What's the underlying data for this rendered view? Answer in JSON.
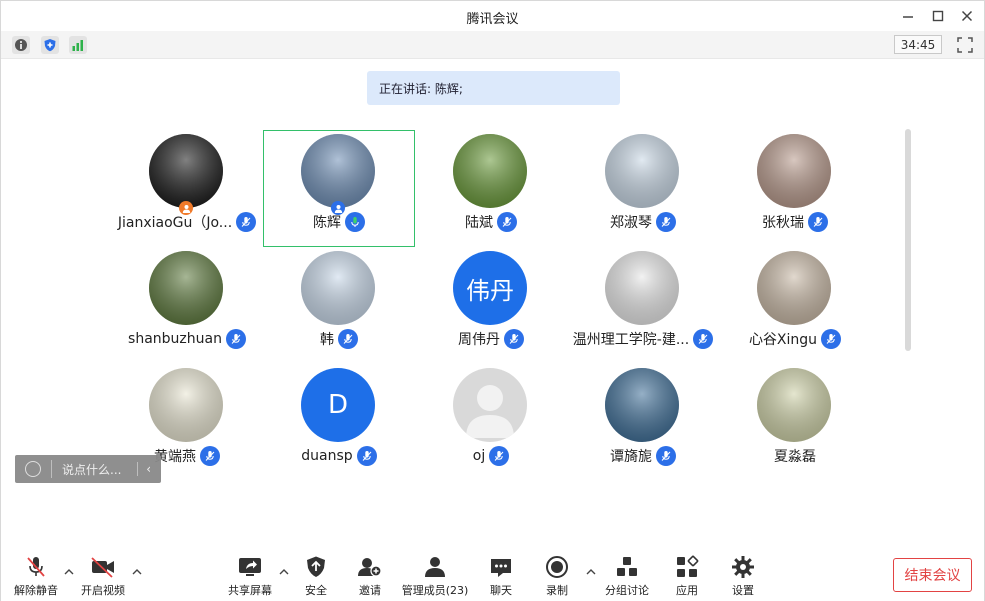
{
  "window": {
    "title": "腾讯会议"
  },
  "status": {
    "timer": "34:45"
  },
  "speaking_banner": "正在讲话: 陈辉;",
  "participants": [
    {
      "name": "JianxiaoGu（Jo...",
      "avatar_type": "photo",
      "avatar_color": "#1a1a1a",
      "badge": "host"
    },
    {
      "name": "陈辉",
      "avatar_type": "photo",
      "avatar_color": "#6f8fb6",
      "badge": "cohost",
      "speaking": true
    },
    {
      "name": "陆斌",
      "avatar_type": "photo",
      "avatar_color": "#6a9a3a"
    },
    {
      "name": "郑淑琴",
      "avatar_type": "photo",
      "avatar_color": "#c9d8e6"
    },
    {
      "name": "张秋瑞",
      "avatar_type": "photo",
      "avatar_color": "#b89a8c"
    },
    {
      "name": "shanbuzhuan",
      "avatar_type": "photo",
      "avatar_color": "#5e7a3e"
    },
    {
      "name": "韩",
      "avatar_type": "photo",
      "avatar_color": "#c9d9ea"
    },
    {
      "name": "周伟丹",
      "avatar_type": "text",
      "avatar_text": "伟丹",
      "avatar_color": "#1e6fe8"
    },
    {
      "name": "温州理工学院-建...",
      "avatar_type": "photo",
      "avatar_color": "#e8e8e8"
    },
    {
      "name": "心谷Xingu",
      "avatar_type": "photo",
      "avatar_color": "#c9b9a6"
    },
    {
      "name": "黄端燕",
      "avatar_type": "photo",
      "avatar_color": "#e9e6d2"
    },
    {
      "name": "duansp",
      "avatar_type": "text",
      "avatar_text": "D",
      "avatar_color": "#1e6fe8"
    },
    {
      "name": "oj",
      "avatar_type": "default",
      "avatar_color": "#d9d9d9"
    },
    {
      "name": "谭旖旎",
      "avatar_type": "photo",
      "avatar_color": "#3f6f98"
    },
    {
      "name": "夏淼磊",
      "avatar_type": "photo",
      "avatar_color": "#cfd2a8",
      "no_mic": true
    }
  ],
  "chat": {
    "placeholder": "说点什么..."
  },
  "toolbar": {
    "unmute": "解除静音",
    "start_video": "开启视频",
    "share_screen": "共享屏幕",
    "security": "安全",
    "invite": "邀请",
    "manage_members": "管理成员(23)",
    "chat": "聊天",
    "record": "录制",
    "breakout": "分组讨论",
    "apps": "应用",
    "settings": "设置",
    "end_meeting": "结束会议"
  },
  "colors": {
    "accent": "#2c6fe8",
    "speaking_border": "#33c06a",
    "end": "#e24343"
  }
}
